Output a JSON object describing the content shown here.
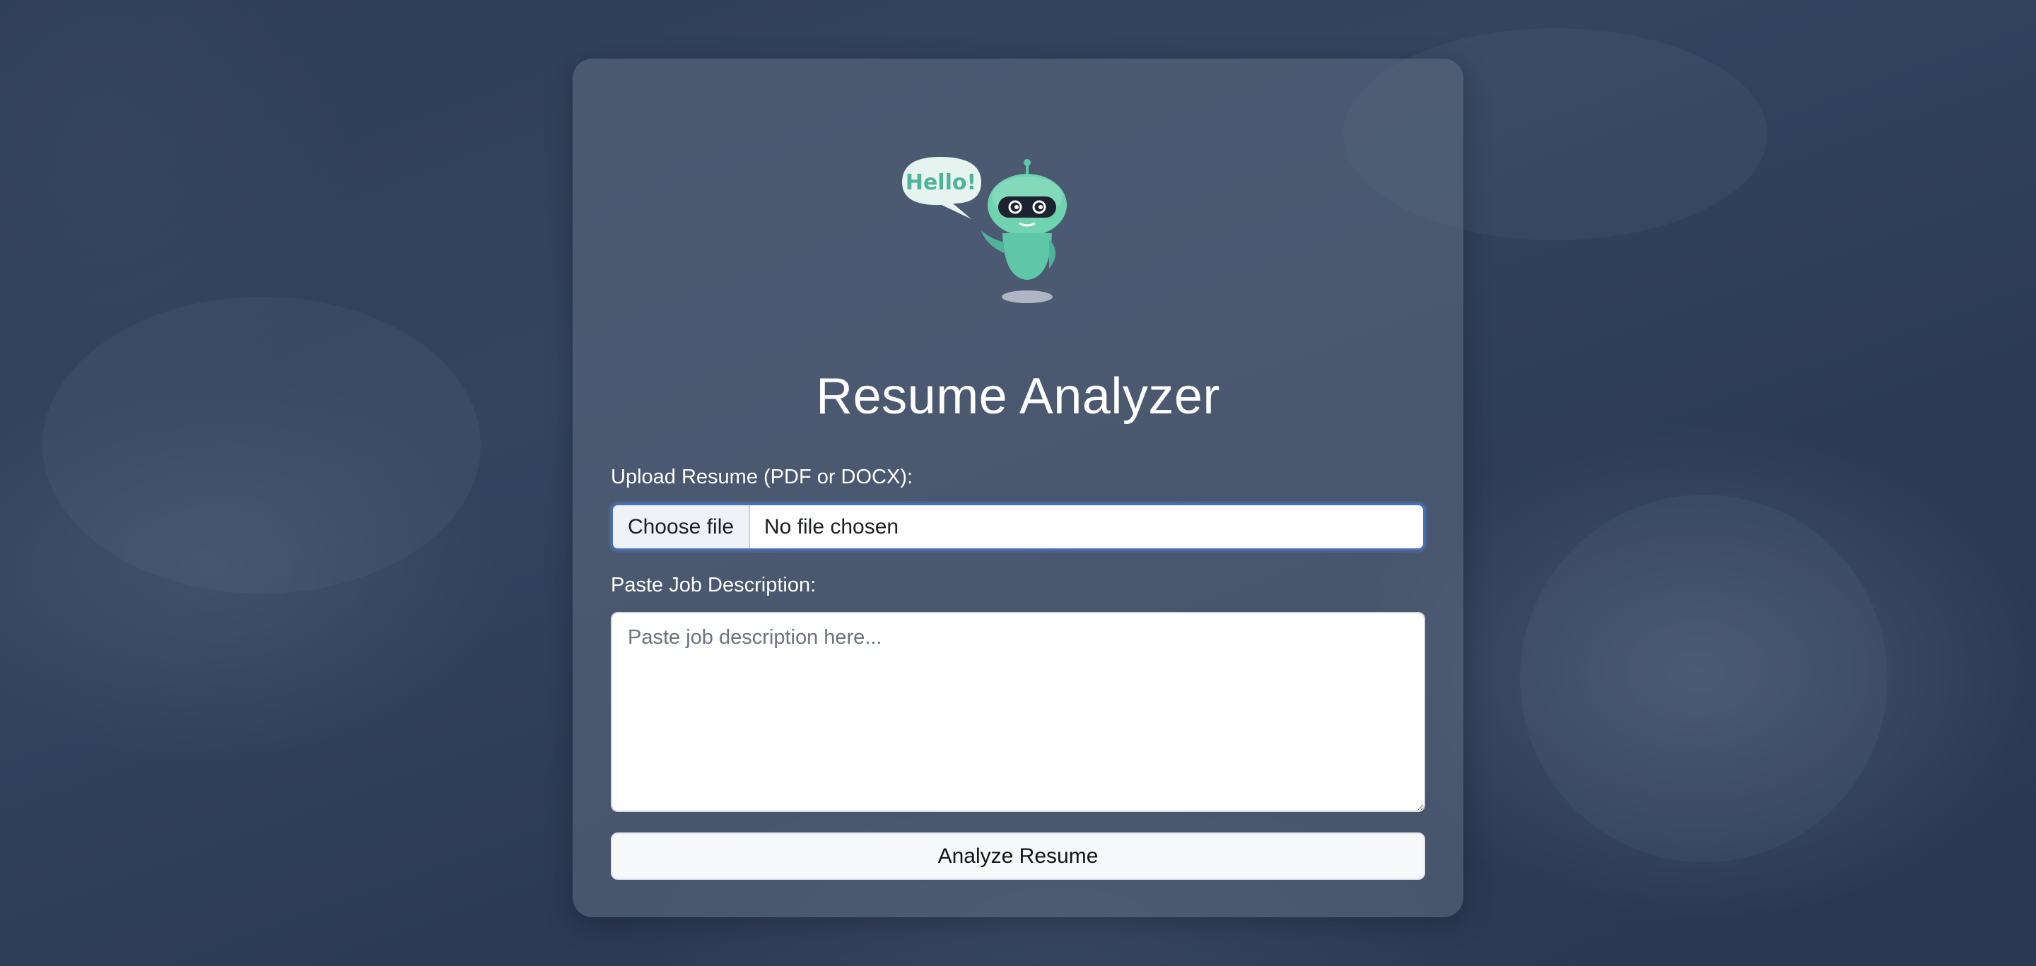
{
  "app": {
    "title": "Resume Analyzer",
    "logo_icon": "robot-hello-icon",
    "logo_text": "Hello!"
  },
  "form": {
    "upload_label": "Upload Resume (PDF or DOCX):",
    "choose_file_label": "Choose file",
    "file_status": "No file chosen",
    "job_label": "Paste Job Description:",
    "job_placeholder": "Paste job description here...",
    "job_value": "",
    "submit_label": "Analyze Resume"
  },
  "colors": {
    "background": "#2f3d57",
    "card": "#5f6e82",
    "focus_border": "#4a6fb7",
    "robot_body": "#6fd3b0",
    "robot_visor": "#1c2230"
  }
}
